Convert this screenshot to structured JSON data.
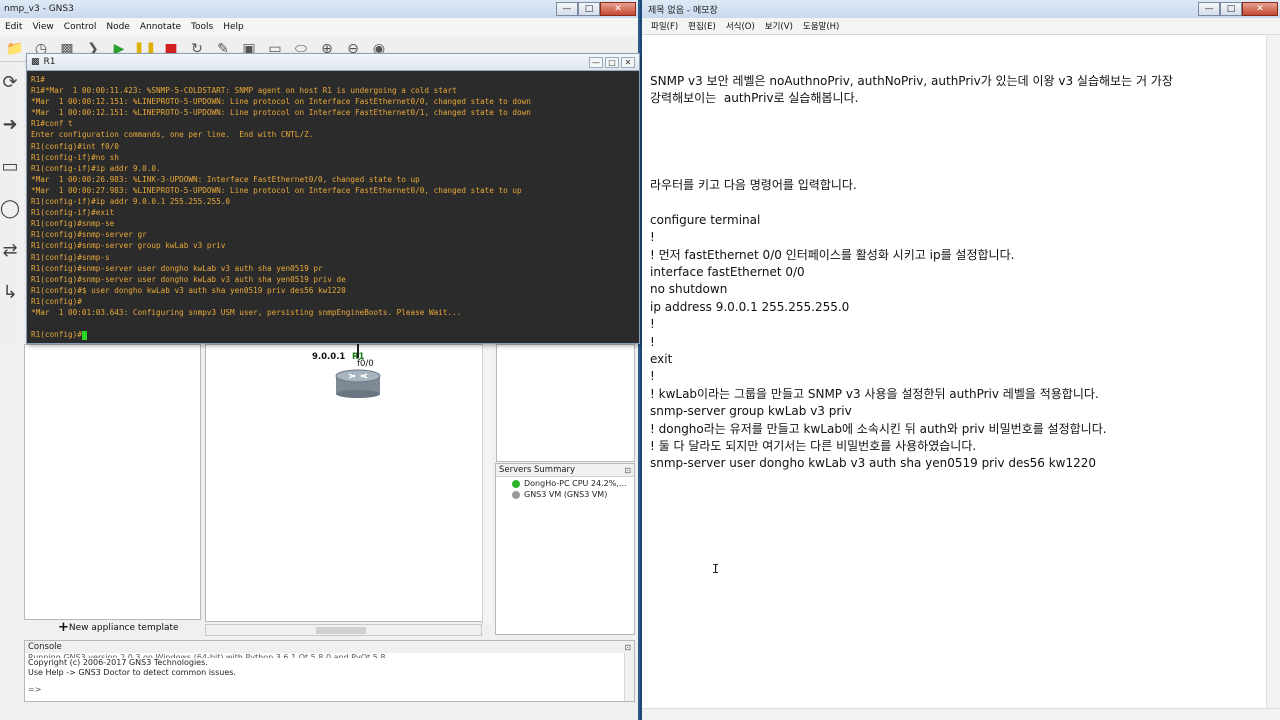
{
  "gns3": {
    "title": "nmp_v3 - GNS3",
    "menu": [
      "Edit",
      "View",
      "Control",
      "Node",
      "Annotate",
      "Tools",
      "Help"
    ],
    "window_controls": [
      "—",
      "□",
      "✕"
    ]
  },
  "console_window": {
    "title": "R1",
    "lines": [
      "R1#",
      "R1#*Mar  1 00:00:11.423: %SNMP-5-COLDSTART: SNMP agent on host R1 is undergoing a cold start",
      "*Mar  1 00:00:12.151: %LINEPROTO-5-UPDOWN: Line protocol on Interface FastEthernet0/0, changed state to down",
      "*Mar  1 00:00:12.151: %LINEPROTO-5-UPDOWN: Line protocol on Interface FastEthernet0/1, changed state to down",
      "R1#conf t",
      "Enter configuration commands, one per line.  End with CNTL/Z.",
      "R1(config)#int f0/0",
      "R1(config-if)#no sh",
      "R1(config-if)#ip addr 9.0.0.",
      "*Mar  1 00:00:26.983: %LINK-3-UPDOWN: Interface FastEthernet0/0, changed state to up",
      "*Mar  1 00:00:27.983: %LINEPROTO-5-UPDOWN: Line protocol on Interface FastEthernet0/0, changed state to up",
      "R1(config-if)#ip addr 9.0.0.1 255.255.255.0",
      "R1(config-if)#exit",
      "R1(config)#snmp-se",
      "R1(config)#snmp-server gr",
      "R1(config)#snmp-server group kwLab v3 priv",
      "R1(config)#snmp-s",
      "R1(config)#snmp-server user dongho kwLab v3 auth sha yen0519 pr",
      "R1(config)#snmp-server user dongho kwLab v3 auth sha yen0519 priv de",
      "R1(config)#$ user dongho kwLab v3 auth sha yen0519 priv des56 kw1220",
      "R1(config)#",
      "*Mar  1 00:01:03.643: Configuring snmpv3 USM user, persisting snmpEngineBoots. Please Wait...",
      ""
    ],
    "prompt": "R1(config)#"
  },
  "topology": {
    "router_ip": "9.0.0.1",
    "router_name": "R1",
    "interface": "f0/0"
  },
  "nodes_panel": {
    "new_appliance": "New appliance template"
  },
  "servers_summary": {
    "title": "Servers Summary",
    "servers": [
      {
        "label": "DongHo-PC CPU 24.2%,...",
        "status": "green"
      },
      {
        "label": "GNS3 VM (GNS3 VM)",
        "status": "gray"
      }
    ]
  },
  "console_panel": {
    "title": "Console",
    "lines": [
      "Running GNS3 version 2.0.3 on Windows (64-bit) with Python 3.6.1 Qt 5.8.0 and PyQt 5.8.",
      "Copyright (c) 2006-2017 GNS3 Technologies.",
      "Use Help -> GNS3 Doctor to detect common issues."
    ],
    "prompt": "=>"
  },
  "notepad": {
    "title": "제목 없음 - 메모장",
    "menu": [
      "파일(F)",
      "편집(E)",
      "서식(O)",
      "보기(V)",
      "도움말(H)"
    ],
    "lines": [
      "",
      "",
      "SNMP v3 보안 레벨은 noAuthnoPriv, authNoPriv, authPriv가 있는데 이왕 v3 실습해보는 거 가장",
      "강력해보이는  authPriv로 실습해봅니다.",
      "",
      "",
      "",
      "",
      "라우터를 키고 다음 명령어를 입력합니다.",
      "",
      "configure terminal",
      "!",
      "! 먼저 fastEthernet 0/0 인터페이스를 활성화 시키고 ip를 설정합니다.",
      "interface fastEthernet 0/0",
      "no shutdown",
      "ip address 9.0.0.1 255.255.255.0",
      "!",
      "!",
      "exit",
      "!",
      "! kwLab이라는 그룹을 만들고 SNMP v3 사용을 설정한뒤 authPriv 레벨을 적용합니다.",
      "snmp-server group kwLab v3 priv",
      "! dongho라는 유저를 만들고 kwLab에 소속시킨 뒤 auth와 priv 비밀번호를 설정합니다.",
      "! 둘 다 달라도 되지만 여기서는 다른 비밀번호를 사용하였습니다.",
      "snmp-server user dongho kwLab v3 auth sha yen0519 priv des56 kw1220"
    ]
  }
}
